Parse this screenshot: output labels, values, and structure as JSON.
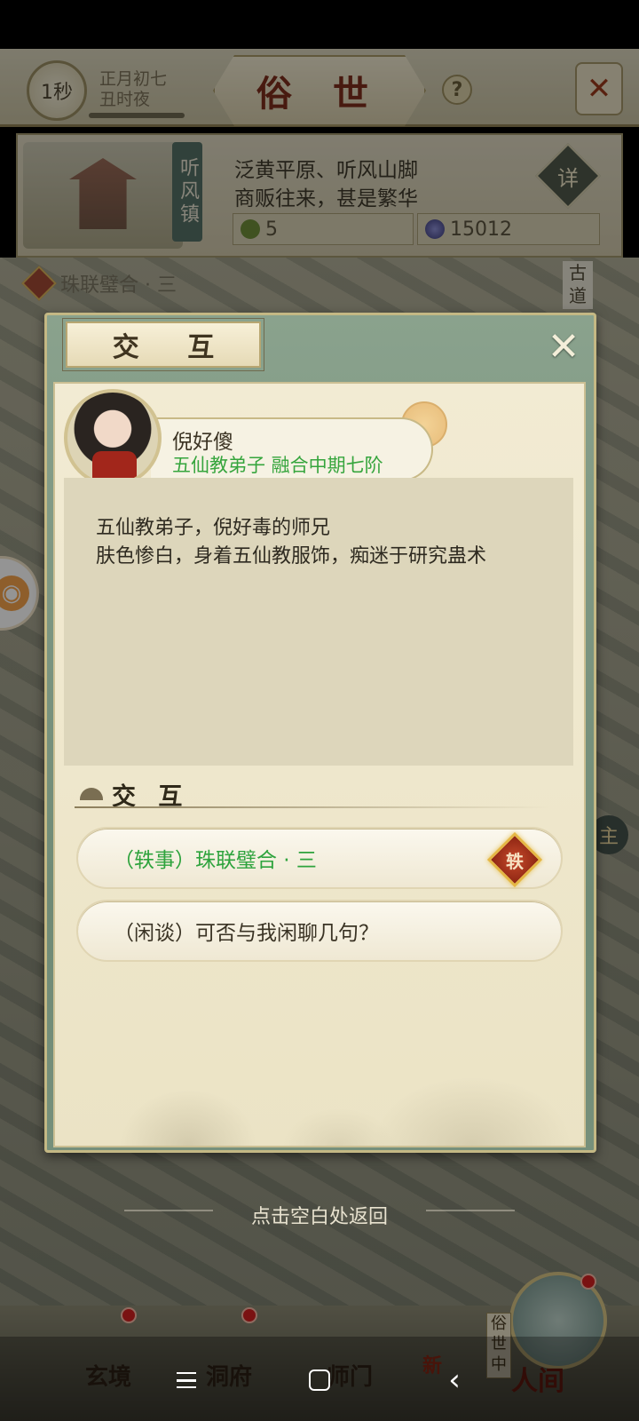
{
  "header": {
    "timer": "1秒",
    "date_line1": "正月初七",
    "date_line2": "丑时夜",
    "title": "俗 世",
    "help_icon": "question-mark-icon",
    "tools_icon": "crossed-tools-icon"
  },
  "town": {
    "name": "听风镇",
    "desc_line1": "泛黄平原、听风山脚",
    "desc_line2": "商贩往来，甚是繁华",
    "detail_label": "详",
    "resource_1": "5",
    "resource_2": "15012"
  },
  "map": {
    "quest_seal": "轶",
    "quest_text": "珠联璧合 · 三",
    "road_sign": "古道",
    "side_char": "主"
  },
  "dialog": {
    "title": "交 互",
    "close_icon": "close-x-icon",
    "npc_name": "倪好傻",
    "npc_title": "五仙教弟子 融合中期七阶",
    "desc_line1": "五仙教弟子，倪好毒的师兄",
    "desc_line2": "肤色惨白，身着五仙教服饰，痴迷于研究蛊术",
    "section_title": "交 互",
    "options": [
      {
        "label": "（轶事）珠联璧合 · 三",
        "badge": "轶",
        "color": "#2ea33d"
      },
      {
        "label": "（闲谈）可否与我闲聊几句？"
      }
    ],
    "return_hint": "点击空白处返回"
  },
  "bottom_nav": {
    "items": [
      "玄境",
      "洞府",
      "师门",
      "新",
      "人间"
    ],
    "world_tag": "俗世中"
  },
  "system_nav": {
    "menu_icon": "menu-icon",
    "home_icon": "home-icon",
    "back_icon": "back-chevron-icon"
  }
}
